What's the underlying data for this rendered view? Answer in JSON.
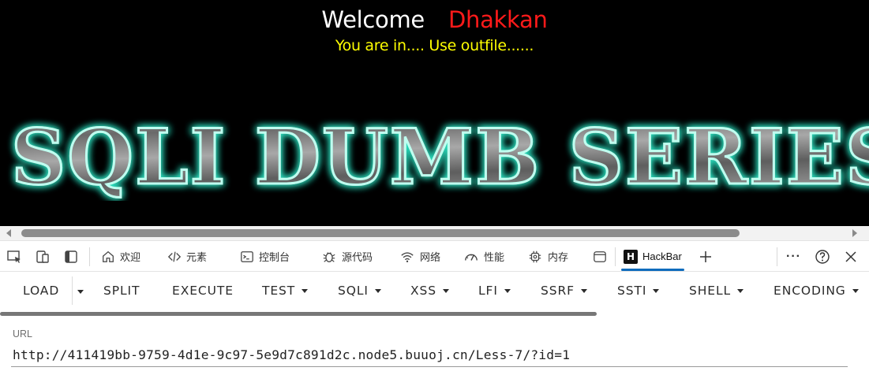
{
  "page": {
    "welcome": "Welcome",
    "name": "Dhakkan",
    "message": "You are in.... Use outfile......",
    "banner": "SQLI DUMB SERIES",
    "colors": {
      "welcome": "#ffffff",
      "name": "#ff1a1a",
      "message": "#ffff00",
      "banner_glow": "#2de0c0"
    }
  },
  "devtools": {
    "tabs": [
      {
        "label": "欢迎",
        "icon": "home-icon"
      },
      {
        "label": "元素",
        "icon": "code-icon"
      },
      {
        "label": "控制台",
        "icon": "console-icon"
      },
      {
        "label": "源代码",
        "icon": "bug-icon"
      },
      {
        "label": "网络",
        "icon": "wifi-icon"
      },
      {
        "label": "性能",
        "icon": "gauge-icon"
      },
      {
        "label": "内存",
        "icon": "chip-icon"
      },
      {
        "label": "",
        "icon": "window-icon"
      },
      {
        "label": "HackBar",
        "icon": "hackbar-logo-icon",
        "active": true
      }
    ],
    "more": "···"
  },
  "hackbar": {
    "buttons": [
      "LOAD",
      "SPLIT",
      "EXECUTE",
      "TEST",
      "SQLI",
      "XSS",
      "LFI",
      "SSRF",
      "SSTI",
      "SHELL",
      "ENCODING"
    ],
    "url_label": "URL",
    "url_value": "http://411419bb-9759-4d1e-9c97-5e9d7c891d2c.node5.buuoj.cn/Less-7/?id=1"
  }
}
